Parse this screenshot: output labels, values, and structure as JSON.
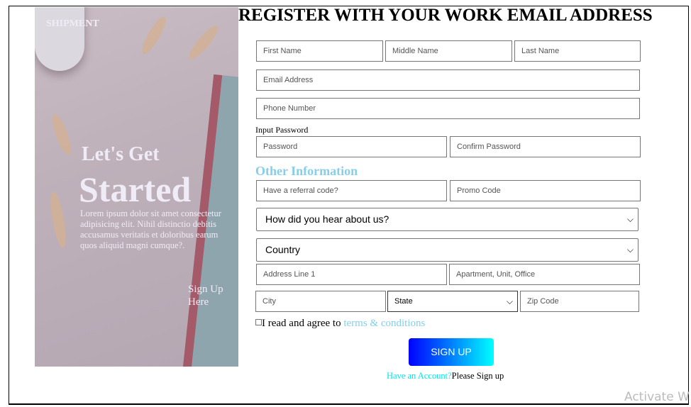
{
  "hero": {
    "brand": "SHIPMENT",
    "heading_line1": "Let's Get",
    "heading_line2": "Started",
    "body": "Lorem ipsum dolor sit amet consectetur adipisicing elit. Nihil distinctio debitis accusamus veritatis et doloribus earum quos aliquid magni cumque?.",
    "sign_up_link": "Sign Up Here"
  },
  "form": {
    "title": "REGISTER WITH YOUR WORK EMAIL ADDRESS",
    "first_name": "First Name",
    "middle_name": "Middle Name",
    "last_name": "Last Name",
    "email": "Email Address",
    "phone": "Phone Number",
    "password_label": "Input Password",
    "password": "Password",
    "confirm_password": "Confirm Password",
    "other_heading": "Other Information",
    "referral": "Have a referral code?",
    "promo": "Promo Code",
    "hear_select": "How did you hear about us?",
    "country_select": "Country",
    "address1": "Address Line 1",
    "address2": "Apartment, Unit, Office",
    "city": "City",
    "state_select": "State",
    "zip": "Zip Code",
    "agree_text": "I read and agree to ",
    "terms_link": "terms & conditions",
    "submit": "SIGN UP",
    "have_account": "Have an Account?",
    "please_sign_up": "Please Sign up"
  },
  "watermark": "Activate W",
  "colors": {
    "accent": "#87ceeb",
    "button_start": "#0000ff",
    "button_end": "#00ffff",
    "link": "#00e5ee"
  }
}
